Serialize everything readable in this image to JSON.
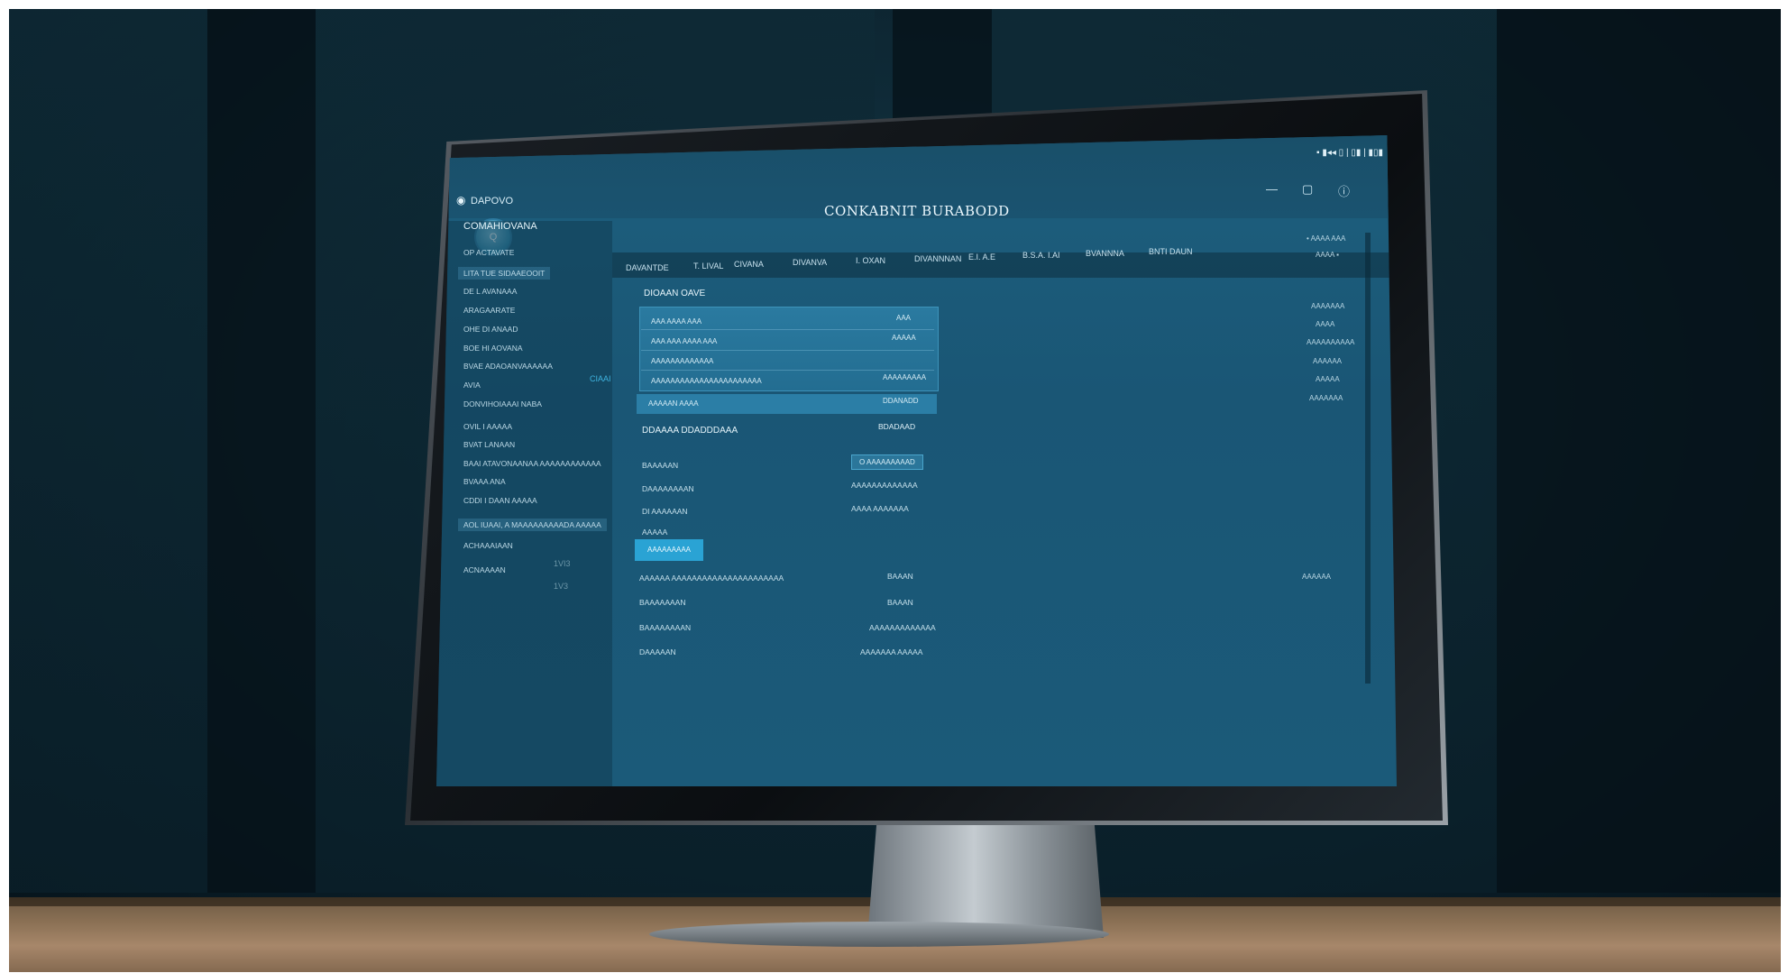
{
  "screen": {
    "header": {
      "small_title": "DAPOVO",
      "avatar_text": "Q",
      "title": "CONKABNIT BURABODD",
      "status_text": "▪ ▮◂◂ ▯ | ▯▮ | ▮▯▮",
      "minimize_glyph": "—",
      "maximize_glyph": "▢",
      "info_glyph": "ⓘ"
    },
    "tabs": [
      "DAVANTDE",
      "T. LIVAL",
      "CIVANA",
      "DIVANVA",
      "I. OXAN",
      "DIVANNNAN",
      "E.I. A.E",
      "B.S.A. I.AI",
      "BVANNNA",
      "BNTI DAUN"
    ],
    "sidebar": {
      "heading": "COMAHIOVANA",
      "items": [
        "OP ACTAVATE",
        "LITA TUE SIDAAEOOIT",
        "DE L AVANAAA",
        "ARAGAARATE",
        "OHE DI ANAAD",
        "BOE HI AOVANA",
        "BVAE ADAOANVAAAAAA",
        "AVIA",
        "DONVIHOIAAAI NABA",
        "OVIL I AAAAA",
        "BVAT LANAAN",
        "BAAI ATAVONAANAA AAAAAAAAAAAA",
        "BVAAA ANA",
        "CDDI I DAAN AAAAA",
        "AOL IUAAI, A MAAAAAAAAADA AAAAA",
        "ACHAAAIAAN",
        "ACNAAAAN"
      ],
      "badges": [
        "CIAAI",
        "1VI3",
        "1V3"
      ]
    },
    "content": {
      "panel_heading": "DIOAAN OAVE",
      "panel_rows": [
        {
          "left": "AAA AAAA AAA",
          "right": "AAA"
        },
        {
          "left": "AAA AAA AAAA AAA",
          "right": "AAAAA"
        },
        {
          "left": "AAAAAAAAAAAAA",
          "right": ""
        },
        {
          "left": "AAAAAAAAAAAAAAAAAAAAAAA",
          "right": "AAAAAAAAA"
        }
      ],
      "bar_row": {
        "left": "AAAAAN AAAA",
        "right": "DDANADD"
      },
      "section": {
        "left": "DDAAAA DDADDDAAA",
        "right": "BDADAAD"
      },
      "fields": [
        {
          "label": "BAAAAAN",
          "value": "O AAAAAAAAAD"
        },
        {
          "label": "DAAAAAAAAN",
          "value": "AAAAAAAAAAAAA"
        },
        {
          "label": "DI AAAAAAN",
          "value": "AAAA AAAAAAA"
        },
        {
          "label": "AAAAA",
          "value": ""
        }
      ],
      "primary_button": "AAAAAAAAA",
      "list": [
        {
          "label": "AAAAAA AAAAAAAAAAAAAAAAAAAAAA",
          "value": "BAAAN"
        },
        {
          "label": "BAAAAAAAN",
          "value": "BAAAN"
        },
        {
          "label": "BAAAAAAAAN",
          "value": "AAAAAAAAAAAAA"
        },
        {
          "label": "DAAAAAN",
          "value": "AAAAAAA AAAAA"
        }
      ]
    },
    "right_column": [
      "• AAAA AAA",
      "AAAA ▪",
      "AAAAAAA",
      "AAAA",
      "AAAAAAAAAA",
      "AAAAAA",
      "AAAAA",
      "AAAAAAA",
      "AAAAAA"
    ]
  }
}
